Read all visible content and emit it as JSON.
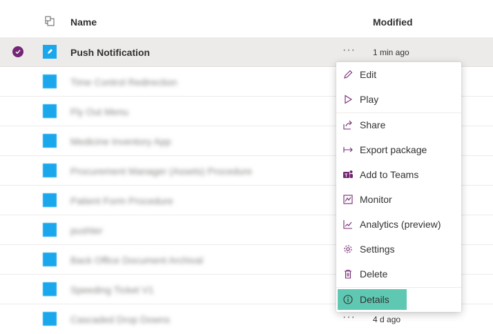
{
  "header": {
    "name_label": "Name",
    "modified_label": "Modified"
  },
  "rows": [
    {
      "name": "Push Notification",
      "modified": "1 min ago",
      "more": "···"
    },
    {
      "name": "Time Control Redirection"
    },
    {
      "name": "Fly Out Menu"
    },
    {
      "name": "Medicine Inventory App"
    },
    {
      "name": "Procurement Manager (Assets) Procedure"
    },
    {
      "name": "Patient Form Procedure"
    },
    {
      "name": "pushter"
    },
    {
      "name": "Back Office Document Archival"
    },
    {
      "name": "Speeding Ticket V1"
    },
    {
      "name": "Cascaded Drop Downs",
      "modified": "4 d ago",
      "more": "···"
    }
  ],
  "context_menu": {
    "items": [
      {
        "label": "Edit",
        "icon": "pencil-icon"
      },
      {
        "label": "Play",
        "icon": "play-icon"
      },
      {
        "label": "Share",
        "icon": "share-icon"
      },
      {
        "label": "Export package",
        "icon": "export-icon"
      },
      {
        "label": "Add to Teams",
        "icon": "teams-icon"
      },
      {
        "label": "Monitor",
        "icon": "monitor-icon"
      },
      {
        "label": "Analytics (preview)",
        "icon": "analytics-icon"
      },
      {
        "label": "Settings",
        "icon": "gear-icon"
      },
      {
        "label": "Delete",
        "icon": "trash-icon"
      },
      {
        "label": "Details",
        "icon": "info-icon"
      }
    ]
  },
  "colors": {
    "accent": "#742774",
    "app_icon": "#1aa7ec",
    "highlight": "#5fc8b2",
    "selected_row": "#edebe9"
  }
}
